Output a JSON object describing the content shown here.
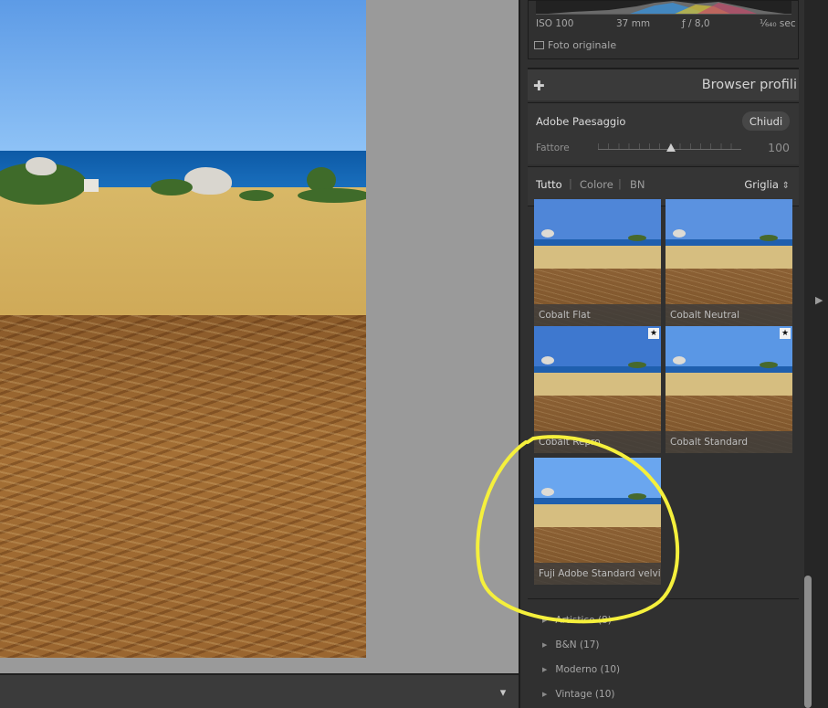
{
  "exif": {
    "iso": "ISO 100",
    "focal": "37 mm",
    "aperture": "ƒ / 8,0",
    "shutter": "¹⁄₆₄₀ sec"
  },
  "original_photo_label": "Foto originale",
  "panel": {
    "title": "Browser profili",
    "plus_icon": "plus-icon"
  },
  "profile": {
    "name": "Adobe Paesaggio",
    "close_label": "Chiudi",
    "amount_label": "Fattore",
    "amount_value": "100",
    "amount_fraction": 0.51
  },
  "filters": {
    "all": "Tutto",
    "color": "Colore",
    "bw": "BN",
    "sep": "|",
    "view_label": "Griglia",
    "view_icon": "up-down-arrows-icon"
  },
  "thumbnails": [
    {
      "label": "Cobalt Flat",
      "favorite": false,
      "sky": "#4f86d8"
    },
    {
      "label": "Cobalt Neutral",
      "favorite": false,
      "sky": "#5b92e0"
    },
    {
      "label": "Cobalt Repro",
      "favorite": true,
      "sky": "#3e78cf"
    },
    {
      "label": "Cobalt Standard",
      "favorite": true,
      "sky": "#5a97e5"
    },
    {
      "label": "Fuji Adobe Standard velvia",
      "favorite": false,
      "sky": "#6aa6ef"
    }
  ],
  "star_glyph": "★",
  "groups": [
    {
      "label": "Artistico (8)"
    },
    {
      "label": "B&N (17)"
    },
    {
      "label": "Moderno (10)"
    },
    {
      "label": "Vintage (10)"
    }
  ],
  "glyphs": {
    "triangle": "▶",
    "chevron_down": "▾",
    "right_arrow": "▶",
    "updown": "⇕"
  },
  "colors": {
    "annotation": "#f5f03c",
    "panel_bg": "#303030"
  }
}
